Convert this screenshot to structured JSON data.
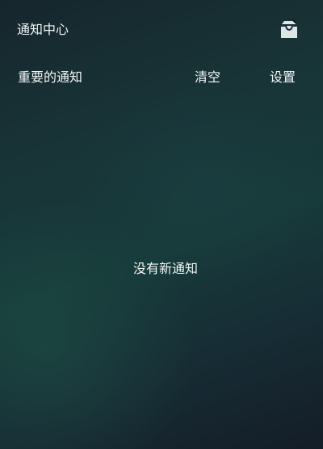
{
  "header": {
    "title": "通知中心",
    "inbox_icon": "inbox-icon"
  },
  "toolbar": {
    "important_label": "重要的通知",
    "clear_label": "清空",
    "settings_label": "设置"
  },
  "empty_state": {
    "message": "没有新通知"
  },
  "colors": {
    "text": "#f2f6f7",
    "background_top": "#16262d",
    "background_mid": "#173a3a",
    "background_bottom": "#141d27"
  }
}
